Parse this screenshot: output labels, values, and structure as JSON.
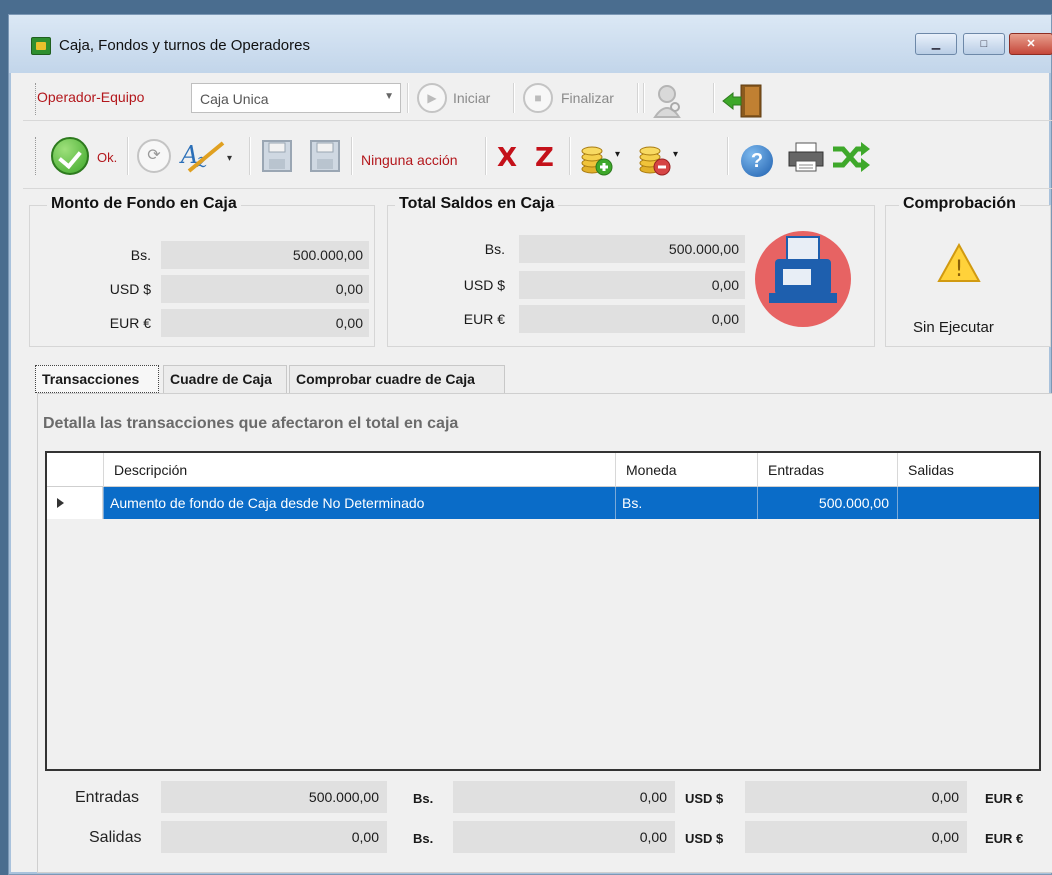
{
  "window": {
    "title": "Caja, Fondos y turnos de Operadores"
  },
  "toolbar1": {
    "operator_label": "Operador-Equipo",
    "operator_value": "Caja Unica",
    "start_label": "Iniciar",
    "finish_label": "Finalizar"
  },
  "toolbar2": {
    "ok_label": "Ok.",
    "action_status": "Ninguna acción",
    "x_label": "X",
    "z_label": "Z",
    "help_glyph": "?"
  },
  "fund": {
    "title": "Monto de Fondo en Caja",
    "rows": [
      {
        "currency": "Bs.",
        "value": "500.000,00"
      },
      {
        "currency": "USD $",
        "value": "0,00"
      },
      {
        "currency": "EUR €",
        "value": "0,00"
      }
    ]
  },
  "totals": {
    "title": "Total Saldos en Caja",
    "rows": [
      {
        "currency": "Bs.",
        "value": "500.000,00"
      },
      {
        "currency": "USD $",
        "value": "0,00"
      },
      {
        "currency": "EUR €",
        "value": "0,00"
      }
    ]
  },
  "check": {
    "title": "Comprobación",
    "status": "Sin Ejecutar",
    "warning_glyph": "!"
  },
  "tabs": [
    {
      "label": "Transacciones",
      "active": true
    },
    {
      "label": "Cuadre de Caja",
      "active": false
    },
    {
      "label": "Comprobar cuadre de Caja",
      "active": false
    }
  ],
  "transactions": {
    "description": "Detalla las transacciones que afectaron el total en caja",
    "columns": [
      "Descripción",
      "Moneda",
      "Entradas",
      "Salidas"
    ],
    "rows": [
      {
        "descripcion": "Aumento de fondo de Caja desde No Determinado",
        "moneda": "Bs.",
        "entradas": "500.000,00",
        "salidas": ""
      }
    ]
  },
  "summary": {
    "entradas_label": "Entradas",
    "salidas_label": "Salidas",
    "entradas": [
      {
        "value": "500.000,00",
        "currency": "Bs."
      },
      {
        "value": "0,00",
        "currency": "USD $"
      },
      {
        "value": "0,00",
        "currency": "EUR €"
      }
    ],
    "salidas": [
      {
        "value": "0,00",
        "currency": "Bs."
      },
      {
        "value": "0,00",
        "currency": "USD $"
      },
      {
        "value": "0,00",
        "currency": "EUR €"
      }
    ]
  },
  "colors": {
    "accent_red": "#b3171c",
    "selection_blue": "#0a6cc8"
  }
}
